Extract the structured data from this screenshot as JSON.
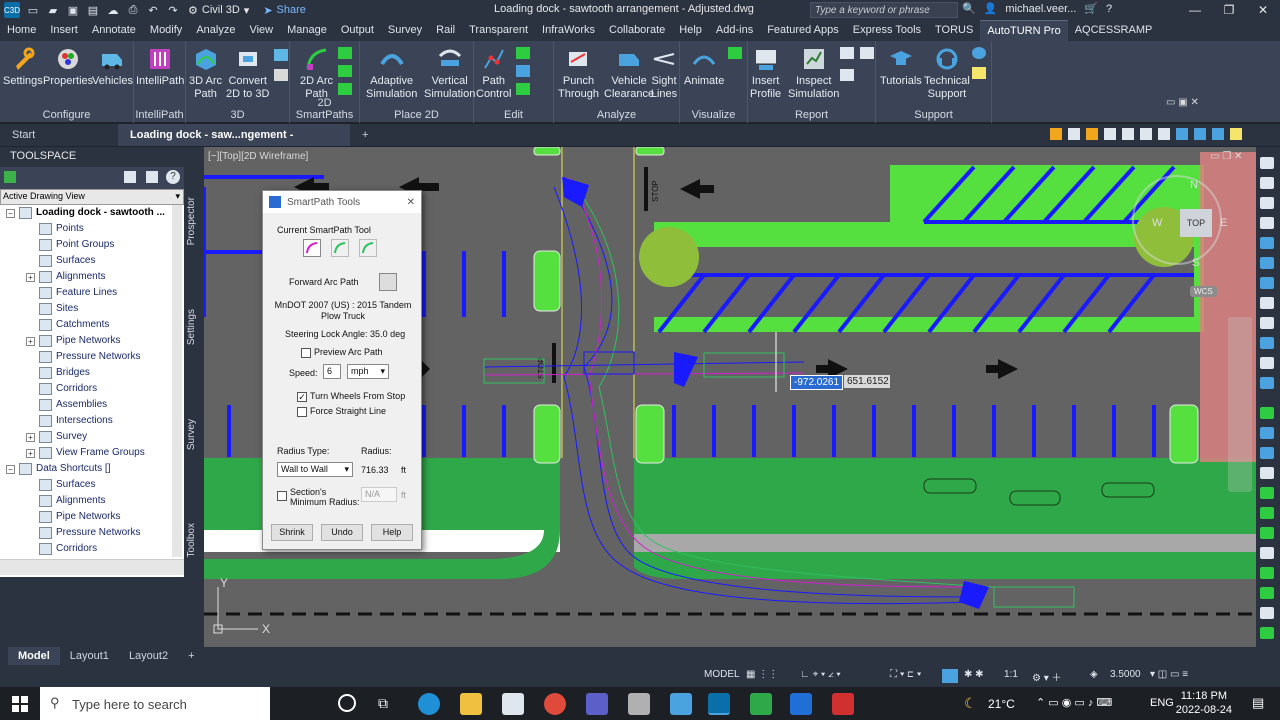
{
  "titlebar": {
    "workspace": "Civil 3D",
    "share": "Share",
    "document_title": "Loading dock - sawtooth arrangement - Adjusted.dwg",
    "search_placeholder": "Type a keyword or phrase",
    "user": "michael.veer..."
  },
  "ribbon_tabs": [
    "Home",
    "Insert",
    "Annotate",
    "Modify",
    "Analyze",
    "View",
    "Manage",
    "Output",
    "Survey",
    "Rail",
    "Transparent",
    "InfraWorks",
    "Collaborate",
    "Help",
    "Add-ins",
    "Featured Apps",
    "Express Tools",
    "TORUS",
    "AutoTURN Pro",
    "AQCESSRAMP"
  ],
  "active_ribbon_tab": "AutoTURN Pro",
  "ribbon_groups": {
    "configure": {
      "title": "Configure",
      "buttons": [
        "Settings",
        "Properties",
        "Vehicles"
      ]
    },
    "intellipath": {
      "title": "IntelliPath",
      "buttons": [
        "IntelliPath"
      ]
    },
    "threed": {
      "title": "3D",
      "buttons": [
        "3D Arc\nPath",
        "Convert\n2D to 3D"
      ]
    },
    "smartpaths": {
      "title": "2D SmartPaths",
      "buttons": [
        "2D Arc\nPath"
      ]
    },
    "place2d": {
      "title": "Place 2D",
      "buttons": [
        "Adaptive\nSimulation",
        "Vertical\nSimulation"
      ]
    },
    "edit": {
      "title": "Edit",
      "buttons": [
        "Path\nControl"
      ]
    },
    "analyze": {
      "title": "Analyze",
      "buttons": [
        "Punch\nThrough",
        "Vehicle\nClearance",
        "Sight\nLines"
      ]
    },
    "visualize": {
      "title": "Visualize",
      "buttons": [
        "Animate"
      ]
    },
    "report": {
      "title": "Report",
      "buttons": [
        "Insert\nProfile",
        "Inspect\nSimulation"
      ]
    },
    "support": {
      "title": "Support",
      "buttons": [
        "Tutorials",
        "Technical\nSupport"
      ]
    }
  },
  "doc_tabs": {
    "start": "Start",
    "active": "Loading dock - saw...ngement - Adjusted*"
  },
  "toolspace": {
    "title": "TOOLSPACE",
    "view": "Active Drawing View",
    "root": "Loading dock - sawtooth ...",
    "items": [
      "Points",
      "Point Groups",
      "Surfaces",
      "Alignments",
      "Feature Lines",
      "Sites",
      "Catchments",
      "Pipe Networks",
      "Pressure Networks",
      "Bridges",
      "Corridors",
      "Assemblies",
      "Intersections",
      "Survey",
      "View Frame Groups"
    ],
    "shortcuts_root": "Data Shortcuts []",
    "shortcuts": [
      "Surfaces",
      "Alignments",
      "Pipe Networks",
      "Pressure Networks",
      "Corridors"
    ],
    "side_tabs": [
      "Prospector",
      "Settings",
      "Survey",
      "Toolbox"
    ]
  },
  "viewport": {
    "label": "[−][Top][2D Wireframe]",
    "coord_x": "-972.0261",
    "coord_y": "651.6152",
    "stop_label": "STOP",
    "viewcube_top": "TOP",
    "wcs": "WCS",
    "compass": {
      "n": "N",
      "s": "S",
      "e": "E",
      "w": "W"
    }
  },
  "dialog": {
    "title": "SmartPath Tools",
    "current_tool_label": "Current SmartPath Tool",
    "mode": "Forward Arc Path",
    "vehicle": "MnDOT 2007 (US) : 2015 Tandem Plow Truck",
    "steering": "Steering Lock Angle: 35.0 deg",
    "preview": "Preview Arc Path",
    "speed_label": "Speed:",
    "speed_value": "6",
    "speed_unit": "mph",
    "turn_wheels": "Turn Wheels From Stop",
    "force_straight": "Force Straight Line",
    "radius_type_label": "Radius Type:",
    "radius_type": "Wall to Wall",
    "radius_label": "Radius:",
    "radius_value": "716.33",
    "radius_unit": "ft",
    "section_min": "Section's\nMinimum Radius:",
    "section_value": "N/A",
    "shrink": "Shrink",
    "undo": "Undo",
    "help": "Help"
  },
  "layout_tabs": [
    "Model",
    "Layout1",
    "Layout2"
  ],
  "statusbar": {
    "model": "MODEL",
    "scale": "1:1",
    "value": "3.5000"
  },
  "taskbar": {
    "search": "Type here to search",
    "weather": "21°C",
    "lang": "ENG",
    "time": "11:18 PM",
    "date": "2022-08-24"
  },
  "colors": {
    "accent": "#3b4457",
    "canvas": "#636363",
    "green": "#2fa84a",
    "blue": "#1a1aff"
  }
}
